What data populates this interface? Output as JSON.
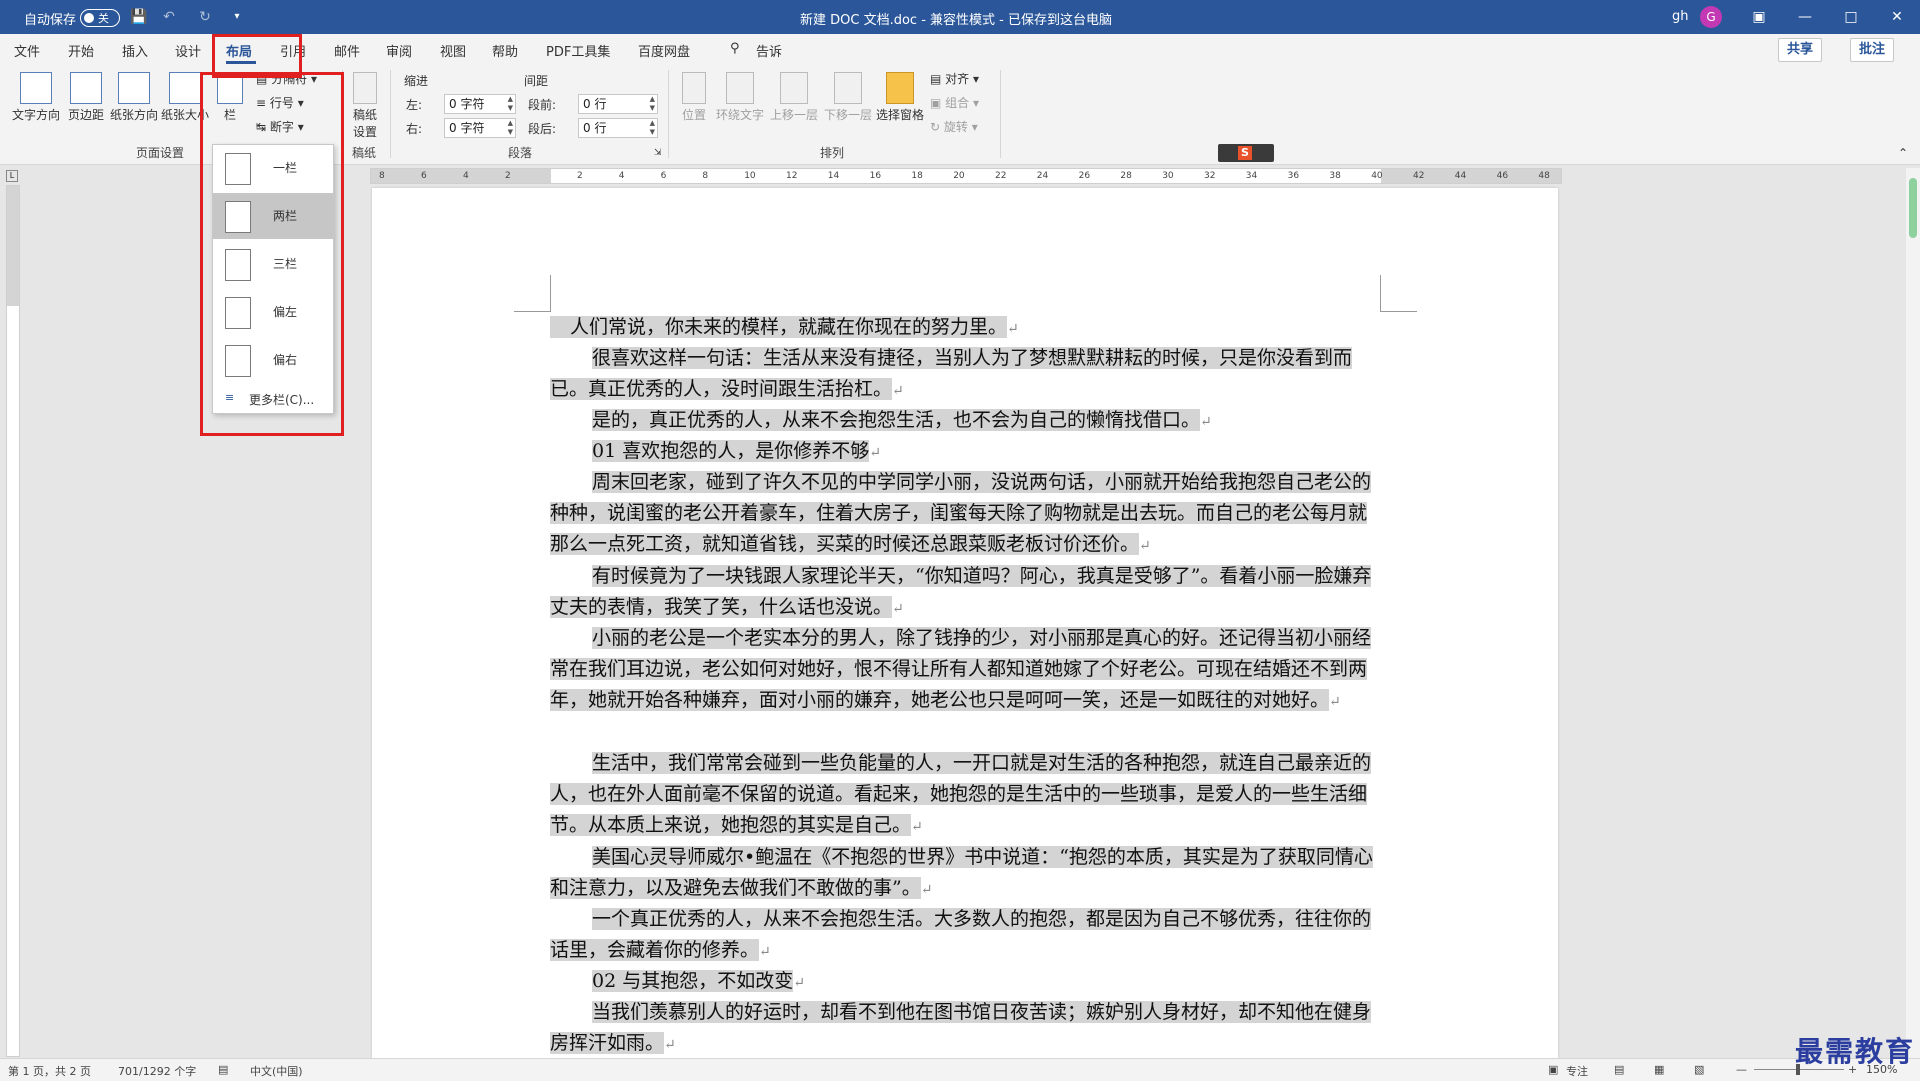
{
  "titlebar": {
    "autosave_label": "自动保存",
    "autosave_state": "关",
    "doc_title": "新建 DOC 文档.doc  -  兼容性模式 - 已保存到这台电脑",
    "user": "gh",
    "avatar_letter": "G"
  },
  "tabs": [
    "文件",
    "开始",
    "插入",
    "设计",
    "布局",
    "引用",
    "邮件",
    "审阅",
    "视图",
    "帮助",
    "PDF工具集",
    "百度网盘"
  ],
  "active_tab": "布局",
  "search_label": "操作说明搜索",
  "search_short": "告诉",
  "right_buttons": {
    "share": "共享",
    "comment": "批注"
  },
  "ribbon": {
    "page_setup": {
      "text_direction": "文字方向",
      "margins": "页边距",
      "orientation": "纸张方向",
      "size": "纸张大小",
      "columns": "栏",
      "breaks": "分隔符",
      "line_numbers": "行号",
      "hyphenation": "断字",
      "group_label": "页面设置"
    },
    "draft": {
      "button": "稿纸设置",
      "group_label": "稿纸"
    },
    "paragraph": {
      "indent_label": "缩进",
      "spacing_label": "间距",
      "left_label": "左:",
      "right_label": "右:",
      "before_label": "段前:",
      "after_label": "段后:",
      "left_value": "0 字符",
      "right_value": "0 字符",
      "before_value": "0 行",
      "after_value": "0 行",
      "group_label": "段落"
    },
    "arrange": {
      "position": "位置",
      "wrap_text": "环绕文字",
      "bring_forward": "上移一层",
      "send_backward": "下移一层",
      "selection_pane": "选择窗格",
      "align": "对齐",
      "group": "组合",
      "rotate": "旋转",
      "group_label": "排列"
    }
  },
  "columns_menu": {
    "items": [
      "一栏",
      "两栏",
      "三栏",
      "偏左",
      "偏右"
    ],
    "selected": "两栏",
    "more": "更多栏(C)..."
  },
  "document": {
    "paragraphs": [
      "人们常说，你未来的模样，就藏在你现在的努力里。",
      "很喜欢这样一句话：生活从来没有捷径，当别人为了梦想默默耕耘的时候，只是你没看到而已。真正优秀的人，没时间跟生活抬杠。",
      "是的，真正优秀的人，从来不会抱怨生活，也不会为自己的懒惰找借口。",
      "01  喜欢抱怨的人，是你修养不够",
      "周末回老家，碰到了许久不见的中学同学小丽，没说两句话，小丽就开始给我抱怨自己老公的种种，说闺蜜的老公开着豪车，住着大房子，闺蜜每天除了购物就是出去玩。而自己的老公每月就那么一点死工资，就知道省钱，买菜的时候还总跟菜贩老板讨价还价。",
      "有时候竟为了一块钱跟人家理论半天，“你知道吗？阿心，我真是受够了”。看着小丽一脸嫌弃丈夫的表情，我笑了笑，什么话也没说。",
      "小丽的老公是一个老实本分的男人，除了钱挣的少，对小丽那是真心的好。还记得当初小丽经常在我们耳边说，老公如何对她好，恨不得让所有人都知道她嫁了个好老公。可现在结婚还不到两年，她就开始各种嫌弃，面对小丽的嫌弃，她老公也只是呵呵一笑，还是一如既往的对她好。",
      "生活中，我们常常会碰到一些负能量的人，一开口就是对生活的各种抱怨，就连自己最亲近的人，也在外人面前毫不保留的说道。看起来，她抱怨的是生活中的一些琐事，是爱人的一些生活细节。从本质上来说，她抱怨的其实是自己。",
      "美国心灵导师威尔•鲍温在《不抱怨的世界》书中说道：“抱怨的本质，其实是为了获取同情心和注意力，以及避免去做我们不敢做的事”。",
      "一个真正优秀的人，从来不会抱怨生活。大多数人的抱怨，都是因为自己不够优秀，往往你的话里，会藏着你的修养。",
      "02  与其抱怨，不如改变",
      "当我们羡慕别人的好运时，却看不到他在图书馆日夜苦读；嫉妒别人身材好，却不知他在健身房挥汗如雨。"
    ]
  },
  "ruler_numbers": [
    "8",
    "6",
    "4",
    "2",
    "2",
    "4",
    "6",
    "8",
    "10",
    "12",
    "14",
    "16",
    "18",
    "20",
    "22",
    "24",
    "26",
    "28",
    "30",
    "32",
    "34",
    "36",
    "38",
    "40",
    "42",
    "44",
    "46",
    "48"
  ],
  "statusbar": {
    "page": "第 1 页，共 2 页",
    "words": "701/1292 个字",
    "language": "中文(中国)",
    "focus": "专注",
    "zoom": "150%"
  },
  "watermark": "最需教育",
  "colors": {
    "brand": "#2b579a",
    "highlight": "#d4d4d4",
    "annotation_red": "#e02020"
  }
}
